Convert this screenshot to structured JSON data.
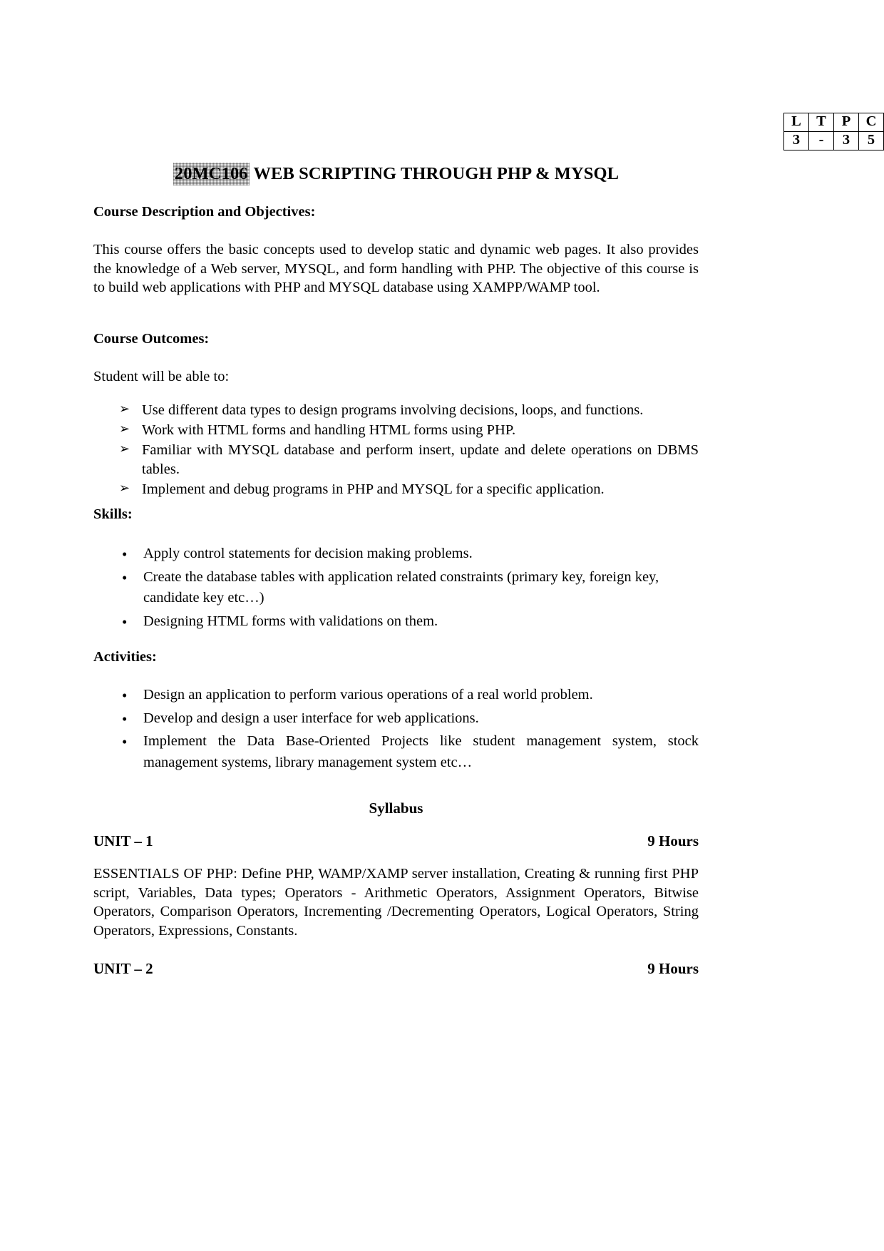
{
  "ltpc_table": {
    "headers": [
      "L",
      "T",
      "P",
      "C"
    ],
    "values": [
      "3",
      "-",
      "3",
      "5"
    ]
  },
  "title": {
    "course_code": "20MC106",
    "course_name": "WEB SCRIPTING THROUGH PHP & MYSQL"
  },
  "course_description": {
    "heading": "Course Description and Objectives:",
    "paragraph": "This course offers the basic concepts used to develop static and dynamic web pages. It also provides the knowledge of a Web server, MYSQL, and form handling with PHP. The objective of this course is to build web applications with PHP and MYSQL database using XAMPP/WAMP tool."
  },
  "course_outcomes": {
    "heading": "Course Outcomes:",
    "intro": "Student will be able to:",
    "marker": "➢",
    "items": [
      "Use different data types to design programs involving decisions, loops, and functions.",
      "Work with HTML forms and handling HTML forms using PHP.",
      "Familiar with MYSQL database and perform insert, update and delete operations on DBMS tables.",
      "Implement and debug programs in PHP and MYSQL for a specific application."
    ]
  },
  "skills": {
    "heading": "Skills:",
    "marker": "•",
    "items": [
      "Apply control statements for decision making problems.",
      "Create the database tables with application related constraints (primary key, foreign key, candidate key etc…)",
      "Designing HTML forms with validations on them."
    ]
  },
  "activities": {
    "heading": "Activities:",
    "marker": "•",
    "items": [
      "Design an application to perform various operations of a real world problem.",
      "Develop and design a user interface for web applications.",
      "Implement the Data Base-Oriented Projects like student management system, stock management systems, library management system etc…"
    ]
  },
  "syllabus": {
    "heading": "Syllabus",
    "units": [
      {
        "label": "UNIT – 1",
        "hours": "9 Hours",
        "content": "ESSENTIALS OF PHP: Define PHP, WAMP/XAMP server installation, Creating & running first PHP script, Variables, Data types; Operators - Arithmetic Operators, Assignment Operators, Bitwise Operators, Comparison Operators, Incrementing /Decrementing Operators, Logical Operators, String Operators, Expressions, Constants."
      },
      {
        "label": "UNIT – 2",
        "hours": "9 Hours",
        "content": ""
      }
    ]
  }
}
